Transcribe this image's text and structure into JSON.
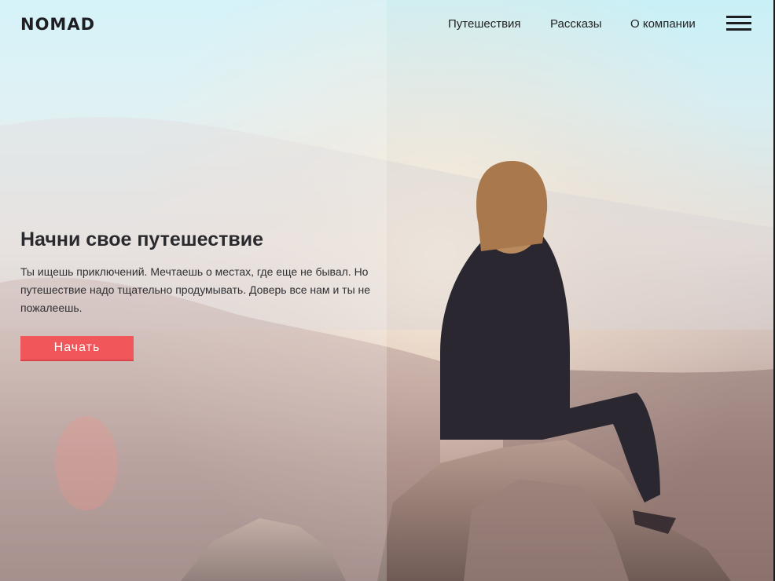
{
  "brand": {
    "logo_text": "NOMAD"
  },
  "nav": {
    "items": [
      {
        "label": "Путешествия"
      },
      {
        "label": "Рассказы"
      },
      {
        "label": "О компании"
      }
    ],
    "menu_icon": "hamburger-menu-icon"
  },
  "hero": {
    "title": "Начни свое путешествие",
    "text": "Ты ищешь приключений. Мечтаешь о местах, где еще не бывал. Но путешествие надо тщательно продумывать. Доверь все нам и ты не пожалеешь.",
    "button_label": "Начать",
    "image": "woman sitting on mountain rock at sunrise"
  },
  "colors": {
    "accent": "#f0565a",
    "text": "#2a2a2e"
  }
}
